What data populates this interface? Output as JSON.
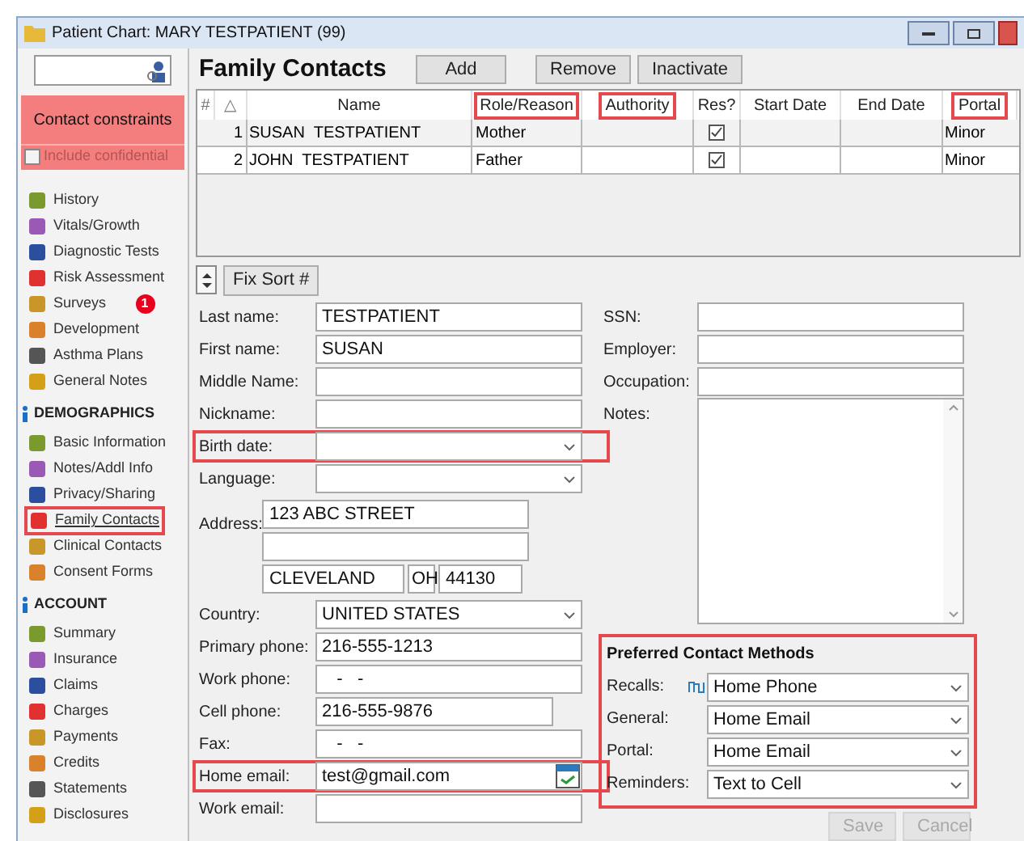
{
  "window": {
    "title": "Patient Chart: MARY TESTPATIENT (99)"
  },
  "sidebar": {
    "constraints": {
      "title": "Contact constraints",
      "checkbox": {
        "label": "Include confidential",
        "checked": false,
        "disabled": true
      }
    },
    "sections": [
      {
        "items": [
          {
            "label": "History",
            "selected": false,
            "highlighted": false
          },
          {
            "label": "Vitals/Growth",
            "selected": false,
            "highlighted": false
          },
          {
            "label": "Diagnostic Tests",
            "selected": false,
            "highlighted": false
          },
          {
            "label": "Risk Assessment",
            "selected": false,
            "highlighted": false
          },
          {
            "label": "Surveys",
            "selected": false,
            "highlighted": false,
            "badge": "1"
          },
          {
            "label": "Development",
            "selected": false,
            "highlighted": false
          },
          {
            "label": "Asthma Plans",
            "selected": false,
            "highlighted": false
          },
          {
            "label": "General Notes",
            "selected": false,
            "highlighted": false
          }
        ]
      },
      {
        "heading": "DEMOGRAPHICS",
        "items": [
          {
            "label": "Basic Information",
            "selected": false,
            "highlighted": false
          },
          {
            "label": "Notes/Addl Info",
            "selected": false,
            "highlighted": false
          },
          {
            "label": "Privacy/Sharing",
            "selected": false,
            "highlighted": false
          },
          {
            "label": "Family Contacts",
            "selected": true,
            "highlighted": true
          },
          {
            "label": "Clinical Contacts",
            "selected": false,
            "highlighted": false
          },
          {
            "label": "Consent Forms",
            "selected": false,
            "highlighted": false
          }
        ]
      },
      {
        "heading": "ACCOUNT",
        "items": [
          {
            "label": "Summary",
            "selected": false,
            "highlighted": false
          },
          {
            "label": "Insurance",
            "selected": false,
            "highlighted": false
          },
          {
            "label": "Claims",
            "selected": false,
            "highlighted": false
          },
          {
            "label": "Charges",
            "selected": false,
            "highlighted": false
          },
          {
            "label": "Payments",
            "selected": false,
            "highlighted": false
          },
          {
            "label": "Credits",
            "selected": false,
            "highlighted": false
          },
          {
            "label": "Statements",
            "selected": false,
            "highlighted": false
          },
          {
            "label": "Disclosures",
            "selected": false,
            "highlighted": false
          }
        ]
      }
    ]
  },
  "header": {
    "title": "Family Contacts",
    "buttons": [
      {
        "label": "Add",
        "disabled": false
      },
      {
        "label": "Remove",
        "disabled": false
      },
      {
        "label": "Inactivate",
        "disabled": false
      }
    ]
  },
  "table": {
    "columns": [
      {
        "label": "#",
        "highlighted": false
      },
      {
        "label": "△",
        "highlighted": false
      },
      {
        "label": "Name",
        "highlighted": false
      },
      {
        "label": "Role/Reason",
        "highlighted": true
      },
      {
        "label": "Authority",
        "highlighted": true
      },
      {
        "label": "Res?",
        "highlighted": false
      },
      {
        "label": "Start Date",
        "highlighted": false
      },
      {
        "label": "End Date",
        "highlighted": false
      },
      {
        "label": "Portal",
        "highlighted": true
      }
    ],
    "rows": [
      {
        "number": "1",
        "name": "SUSAN  TESTPATIENT",
        "role": "Mother",
        "res": true,
        "portal": "Minor"
      },
      {
        "number": "2",
        "name": "JOHN  TESTPATIENT",
        "role": "Father",
        "res": true,
        "portal": "Minor"
      }
    ]
  },
  "fix_sort": {
    "label": "Fix Sort #"
  },
  "form_left": [
    {
      "kind": "text",
      "label": "Last name:",
      "value": "TESTPATIENT",
      "highlighted": false
    },
    {
      "kind": "text",
      "label": "First name:",
      "value": "SUSAN",
      "highlighted": false
    },
    {
      "kind": "text",
      "label": "Middle Name:",
      "highlighted": false
    },
    {
      "kind": "text",
      "label": "Nickname:",
      "highlighted": false
    },
    {
      "kind": "select",
      "label": "Birth date:",
      "highlighted": true
    },
    {
      "kind": "select",
      "label": "Language:",
      "highlighted": false
    },
    {
      "kind": "address",
      "label": "Address:",
      "lines": [
        "123 ABC STREET"
      ],
      "city": "CLEVELAND",
      "state": "OH",
      "zip": "44130",
      "highlighted": false
    },
    {
      "kind": "select",
      "label": "Country:",
      "value": "UNITED STATES",
      "highlighted": false
    },
    {
      "kind": "text",
      "label": "Primary phone:",
      "value": "216-555-1213",
      "highlighted": false
    },
    {
      "kind": "text",
      "label": "Work phone:",
      "value": "   -   -",
      "highlighted": false
    },
    {
      "kind": "short",
      "label": "Cell phone:",
      "value": "216-555-9876",
      "highlighted": false
    },
    {
      "kind": "text",
      "label": "Fax:",
      "value": "   -   -",
      "highlighted": false
    },
    {
      "kind": "email",
      "label": "Home email:",
      "value": "test@gmail.com",
      "highlighted": true
    },
    {
      "kind": "text",
      "label": "Work email:",
      "highlighted": false
    }
  ],
  "form_right": [
    {
      "kind": "text",
      "label": "SSN:"
    },
    {
      "kind": "text",
      "label": "Employer:"
    },
    {
      "kind": "text",
      "label": "Occupation:"
    },
    {
      "kind": "textarea",
      "label": "Notes:"
    }
  ],
  "preferred": {
    "title": "Preferred Contact Methods",
    "highlighted": true,
    "rows": [
      {
        "label": "Recalls:",
        "value": "Home Phone",
        "linked": true
      },
      {
        "label": "General:",
        "value": "Home Email",
        "linked": false
      },
      {
        "label": "Portal:",
        "value": "Home Email",
        "linked": false
      },
      {
        "label": "Reminders:",
        "value": "Text to Cell",
        "linked": false
      }
    ]
  },
  "footer": {
    "buttons": [
      {
        "label": "Save",
        "disabled": true
      },
      {
        "label": "Cancel",
        "disabled": true
      }
    ]
  }
}
